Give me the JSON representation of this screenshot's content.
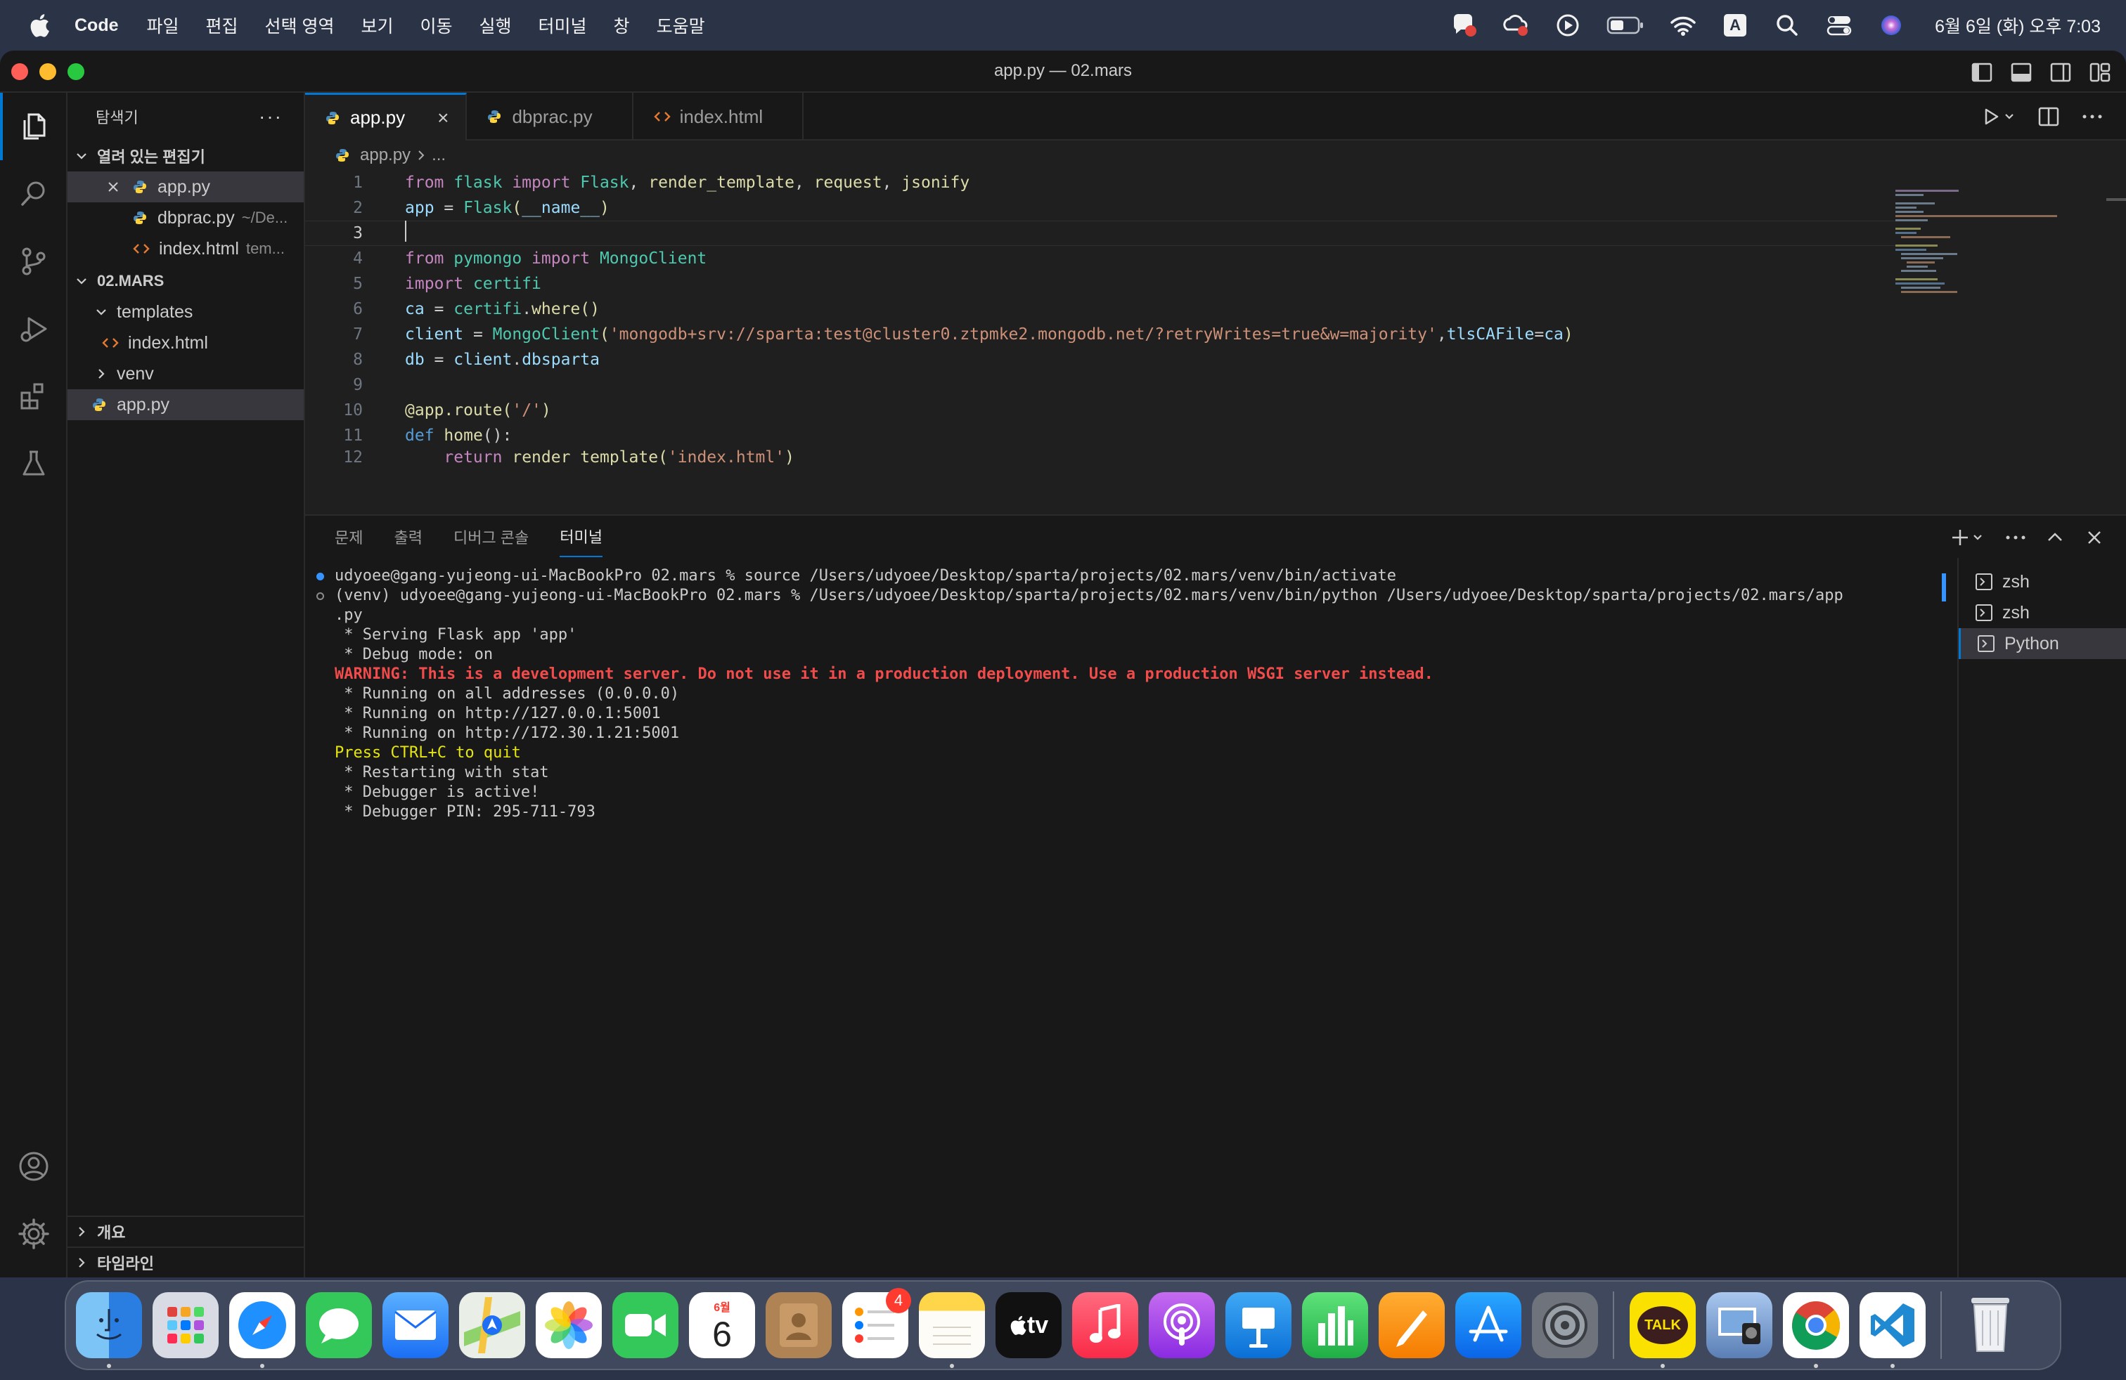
{
  "menubar": {
    "app_name": "Code",
    "items": [
      "파일",
      "편집",
      "선택 영역",
      "보기",
      "이동",
      "실행",
      "터미널",
      "창",
      "도움말"
    ],
    "input_indicator": "A",
    "clock": "6월 6일 (화) 오후 7:03"
  },
  "window": {
    "title": "app.py — 02.mars"
  },
  "sidebar": {
    "header": "탐색기",
    "more": "···",
    "open_editors": {
      "label": "열려 있는 편집기",
      "items": [
        {
          "name": "app.py",
          "hint": ""
        },
        {
          "name": "dbprac.py",
          "hint": "~/De..."
        },
        {
          "name": "index.html",
          "hint": "tem..."
        }
      ]
    },
    "project": {
      "label": "02.MARS",
      "templates": "templates",
      "index": "index.html",
      "venv": "venv",
      "app": "app.py"
    },
    "outline": "개요",
    "timeline": "타임라인"
  },
  "editor": {
    "tabs": [
      {
        "label": "app.py",
        "close": "×"
      },
      {
        "label": "dbprac.py"
      },
      {
        "label": "index.html"
      }
    ],
    "breadcrumb": {
      "file": "app.py",
      "rest": "..."
    },
    "lines": {
      "l1": {
        "num": "1",
        "t1": "from",
        "t2": " flask ",
        "t3": "import",
        "t4": " Flask",
        "t5": ", ",
        "t6": "render_template",
        "t7": ", ",
        "t8": "request",
        "t9": ", ",
        "t10": "jsonify"
      },
      "l2": {
        "num": "2",
        "t1": "app",
        "t2": " = ",
        "t3": "Flask",
        "t4": "(",
        "t5": "__name__",
        "t6": ")"
      },
      "l3": {
        "num": "3"
      },
      "l4": {
        "num": "4",
        "t1": "from",
        "t2": " pymongo ",
        "t3": "import",
        "t4": " MongoClient"
      },
      "l5": {
        "num": "5",
        "t1": "import",
        "t2": " certifi"
      },
      "l6": {
        "num": "6",
        "t1": "ca",
        "t2": " = ",
        "t3": "certifi",
        "t4": ".",
        "t5": "where",
        "t6": "()"
      },
      "l7": {
        "num": "7",
        "t1": "client",
        "t2": " = ",
        "t3": "MongoClient",
        "t4": "(",
        "t5": "'mongodb+srv://sparta:test@cluster0.ztpmke2.mongodb.net/?retryWrites=true&w=majority'",
        "t6": ",",
        "t7": "tlsCAFile",
        "t8": "=",
        "t9": "ca",
        "t10": ")"
      },
      "l8": {
        "num": "8",
        "t1": "db",
        "t2": " = ",
        "t3": "client",
        "t4": ".",
        "t5": "dbsparta"
      },
      "l9": {
        "num": "9"
      },
      "l10": {
        "num": "10",
        "t1": "@app.route",
        "t2": "(",
        "t3": "'/'",
        "t4": ")"
      },
      "l11": {
        "num": "11",
        "t1": "def",
        "t2": " ",
        "t3": "home",
        "t4": "():"
      },
      "l12": {
        "num": "12",
        "t1": "    return",
        "t2": " ",
        "t3": "render_template",
        "t4": "(",
        "t5": "'index.html'",
        "t6": ")"
      }
    }
  },
  "panel": {
    "tabs": [
      "문제",
      "출력",
      "디버그 콘솔",
      "터미널"
    ],
    "terminal_lines": [
      "udyoee@gang-yujeong-ui-MacBookPro 02.mars % source /Users/udyoee/Desktop/sparta/projects/02.mars/venv/bin/activate",
      "(venv) udyoee@gang-yujeong-ui-MacBookPro 02.mars % /Users/udyoee/Desktop/sparta/projects/02.mars/venv/bin/python /Users/udyoee/Desktop/sparta/projects/02.mars/app",
      ".py",
      " * Serving Flask app 'app'",
      " * Debug mode: on",
      "WARNING: This is a development server. Do not use it in a production deployment. Use a production WSGI server instead.",
      " * Running on all addresses (0.0.0.0)",
      " * Running on http://127.0.0.1:5001",
      " * Running on http://172.30.1.21:5001",
      "Press CTRL+C to quit",
      " * Restarting with stat",
      " * Debugger is active!",
      " * Debugger PIN: 295-711-793"
    ],
    "terminals": [
      "zsh",
      "zsh",
      "Python"
    ]
  },
  "dock": {
    "calendar_month": "6월",
    "calendar_day": "6",
    "reminders_badge": "4",
    "tv_label": "tv",
    "talk_label": "TALK"
  },
  "colors": {
    "accent": "#0078d4",
    "warning": "#f14c4c",
    "terminal_yellow": "#e5e510"
  }
}
